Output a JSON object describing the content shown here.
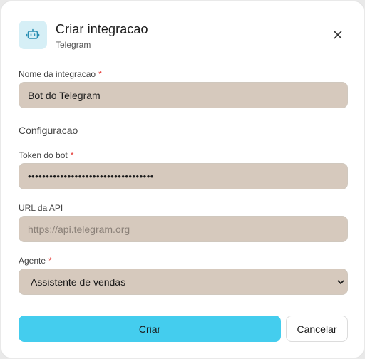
{
  "dialog": {
    "title": "Criar integracao",
    "subtitle": "Telegram",
    "header_icon": "bot-icon",
    "close_icon": "close-icon",
    "accent_color": "#44cdee"
  },
  "form": {
    "name": {
      "label": "Nome da integracao",
      "required_mark": "*",
      "value": "Bot do Telegram"
    },
    "section_title": "Configuracao",
    "token": {
      "label": "Token do bot",
      "required_mark": "*",
      "value": "•••••••••••••••••••••••••••••••••••"
    },
    "api_url": {
      "label": "URL da API",
      "placeholder": "https://api.telegram.org",
      "value": ""
    },
    "agent": {
      "label": "Agente",
      "required_mark": "*",
      "selected": "Assistente de vendas"
    }
  },
  "actions": {
    "create_label": "Criar",
    "cancel_label": "Cancelar"
  }
}
